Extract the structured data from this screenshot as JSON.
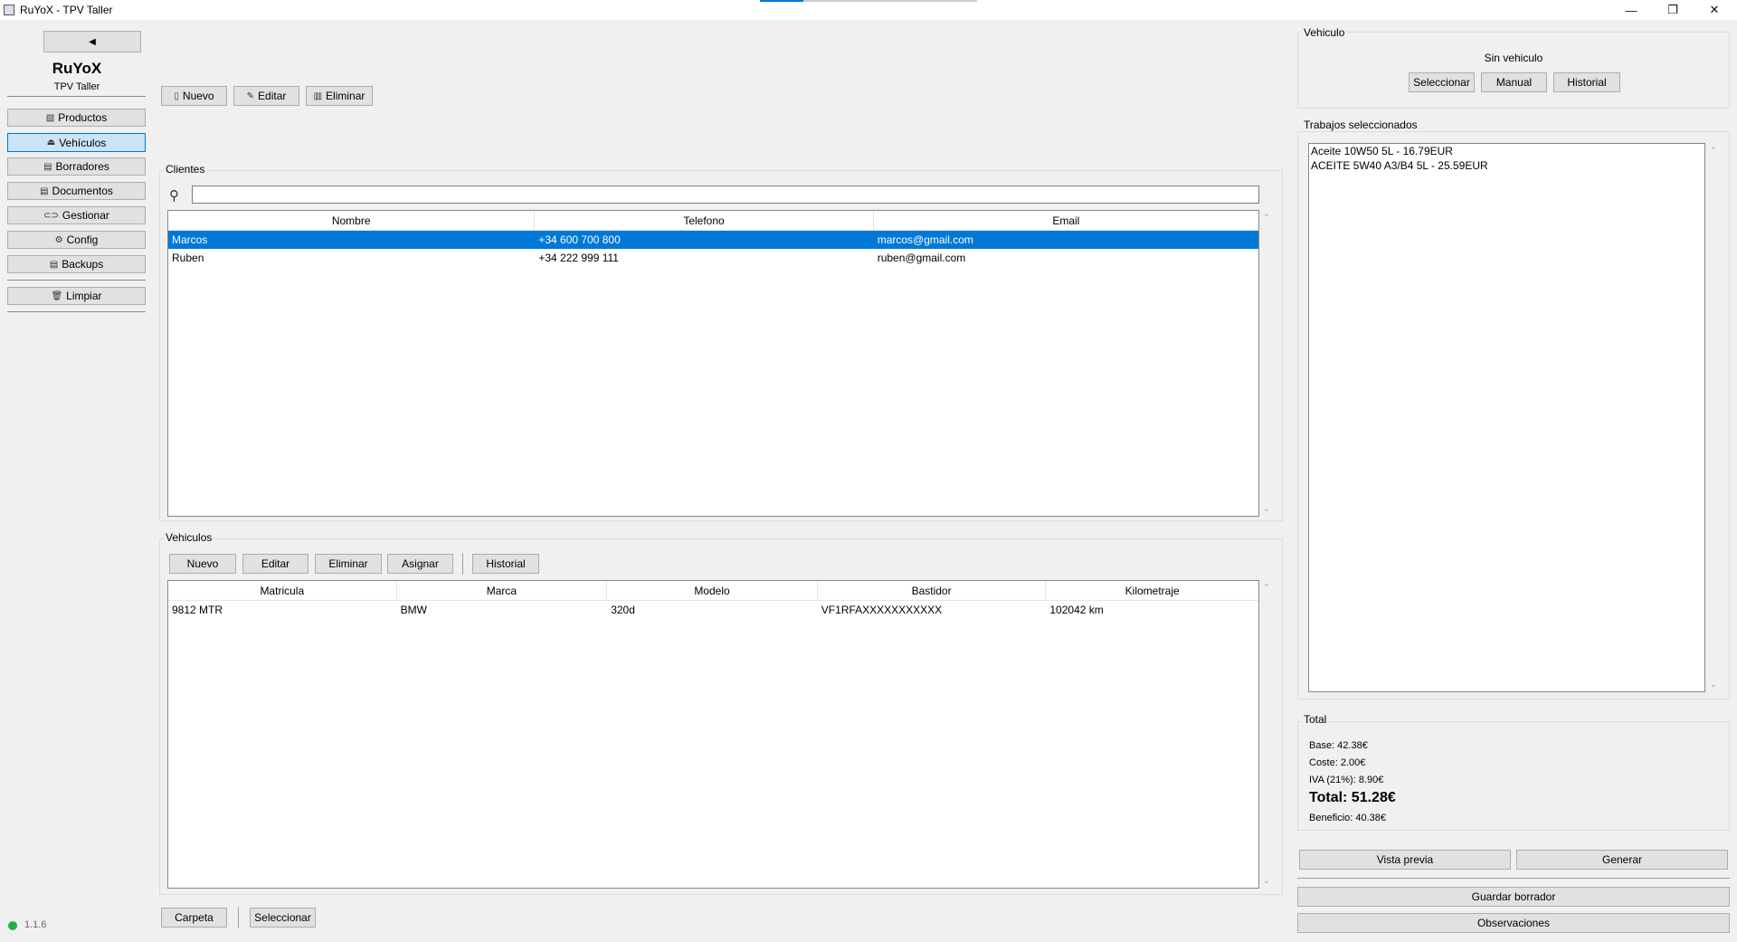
{
  "window": {
    "title": "RuYoX - TPV Taller",
    "progress": 0.2
  },
  "sidebar": {
    "collapse_label": "◀",
    "brand_name": "RuYoX",
    "brand_sub": "TPV Taller",
    "items": [
      {
        "label": "Productos",
        "icon": "box-icon",
        "glyph": "▧"
      },
      {
        "label": "Vehículos",
        "icon": "car-icon",
        "glyph": "⏏"
      },
      {
        "label": "Borradores",
        "icon": "drafts-icon",
        "glyph": "▤"
      },
      {
        "label": "Documentos",
        "icon": "document-icon",
        "glyph": "▤"
      },
      {
        "label": "Gestionar",
        "icon": "link-icon",
        "glyph": "⊂⊃"
      },
      {
        "label": "Config",
        "icon": "gear-icon",
        "glyph": "⚙"
      },
      {
        "label": "Backups",
        "icon": "backup-icon",
        "glyph": "▤"
      },
      {
        "label": "Limpiar",
        "icon": "trash-icon",
        "glyph": "🗑"
      }
    ],
    "version": "1.1.6",
    "status_color": "#22b14c"
  },
  "toolbar": {
    "nuevo": "Nuevo",
    "editar": "Editar",
    "eliminar": "Eliminar"
  },
  "clientes": {
    "title": "Clientes",
    "search_value": "",
    "columns": [
      "Nombre",
      "Telefono",
      "Email"
    ],
    "rows": [
      {
        "nombre": "Marcos",
        "telefono": "+34 600 700 800",
        "email": "marcos@gmail.com",
        "selected": true
      },
      {
        "nombre": "Ruben",
        "telefono": "+34 222 999 111",
        "email": "ruben@gmail.com",
        "selected": false
      }
    ]
  },
  "vehiculos": {
    "title": "Vehiculos",
    "buttons": {
      "nuevo": "Nuevo",
      "editar": "Editar",
      "eliminar": "Eliminar",
      "asignar": "Asignar",
      "historial": "Historial"
    },
    "columns": [
      "Matricula",
      "Marca",
      "Modelo",
      "Bastidor",
      "Kilometraje"
    ],
    "rows": [
      {
        "matricula": "9812 MTR",
        "marca": "BMW",
        "modelo": "320d",
        "bastidor": "VF1RFAXXXXXXXXXXX",
        "km": "102042 km"
      }
    ]
  },
  "bottom": {
    "carpeta": "Carpeta",
    "seleccionar": "Seleccionar"
  },
  "vehiculo_panel": {
    "title": "Vehiculo",
    "status": "Sin vehiculo",
    "seleccionar": "Seleccionar",
    "manual": "Manual",
    "historial": "Historial"
  },
  "trabajos": {
    "title": "Trabajos seleccionados",
    "items": [
      "Aceite 10W50 5L - 16.79EUR",
      "ACEITE 5W40 A3/B4 5L - 25.59EUR"
    ]
  },
  "total": {
    "title": "Total",
    "base": "Base: 42.38€",
    "coste": "Coste: 2.00€",
    "iva": "IVA (21%): 8.90€",
    "total": "Total: 51.28€",
    "beneficio": "Beneficio: 40.38€"
  },
  "actions": {
    "vista_previa": "Vista previa",
    "generar": "Generar",
    "guardar_borrador": "Guardar borrador",
    "observaciones": "Observaciones"
  },
  "colors": {
    "selection": "#0078d7",
    "active_nav": "#cce4f7"
  }
}
